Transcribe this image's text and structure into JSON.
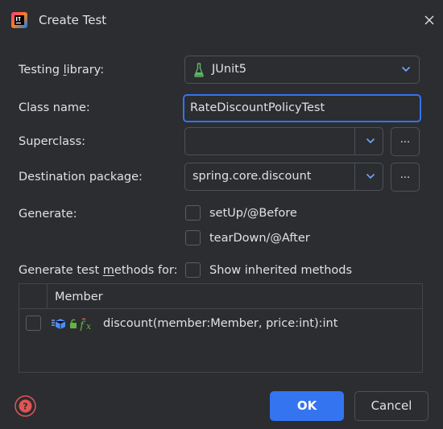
{
  "dialog": {
    "title": "Create Test",
    "icons": {
      "app": "intellij-idea-icon",
      "close": "close-icon"
    }
  },
  "form": {
    "testing_library": {
      "label_pre": "Testing ",
      "label_u": "l",
      "label_post": "ibrary:",
      "value": "JUnit5",
      "icon": "flask-icon"
    },
    "class_name": {
      "label": "Class name:",
      "value": "RateDiscountPolicyTest"
    },
    "superclass": {
      "label": "Superclass:",
      "value": "",
      "browse": "..."
    },
    "destination_package": {
      "label": "Destination package:",
      "value": "spring.core.discount",
      "browse": "..."
    },
    "generate": {
      "label": "Generate:",
      "options": [
        {
          "label": "setUp/@Before",
          "checked": false
        },
        {
          "label": "tearDown/@After",
          "checked": false
        }
      ]
    },
    "methods_for": {
      "label_pre": "Generate test ",
      "label_u": "m",
      "label_post": "ethods for:",
      "show_inherited": {
        "label": "Show inherited methods",
        "checked": false
      }
    }
  },
  "table": {
    "header": "Member",
    "rows": [
      {
        "checked": false,
        "signature": "discount(member:Member, price:int):int"
      }
    ]
  },
  "footer": {
    "ok": "OK",
    "cancel": "Cancel",
    "help_icon": "help-icon"
  },
  "colors": {
    "accent": "#3574f0",
    "background": "#2b2d30",
    "text": "#dfe1e5",
    "help_red": "#e05555",
    "flask_green": "#5fb865"
  }
}
